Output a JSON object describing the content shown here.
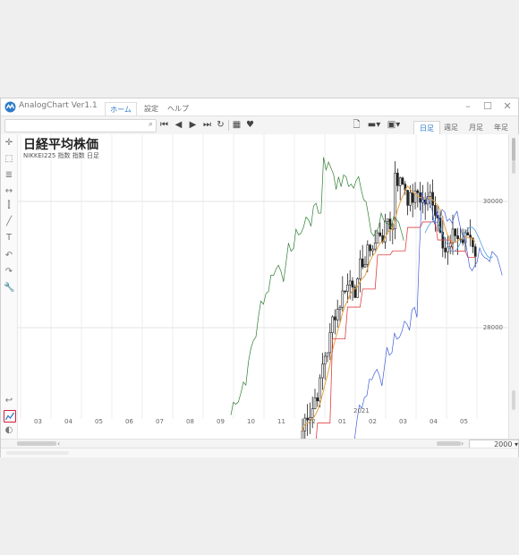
{
  "app": {
    "title": "AnalogChart Ver1.1"
  },
  "menu": {
    "tabs": [
      "ホーム",
      "設定",
      "ヘルプ"
    ],
    "active": 0
  },
  "toolbar": {
    "search_icon": "search-icon",
    "period_tabs": [
      "日足",
      "週足",
      "月足",
      "年足"
    ],
    "active_period": 0
  },
  "chart": {
    "title": "日経平均株価",
    "subtitle": "NIKKEI225  指数  指数  日足",
    "y_labels": [
      "30000",
      "28000"
    ],
    "year_label": "2021",
    "month_labels": [
      "03",
      "04",
      "05",
      "06",
      "07",
      "08",
      "09",
      "10",
      "11",
      "12",
      "01",
      "02",
      "03",
      "04",
      "05"
    ]
  },
  "footer": {
    "year_select": "2000"
  },
  "chart_data": {
    "type": "line",
    "title": "日経平均株価",
    "ylim": [
      26000,
      31000
    ],
    "y_ticks": [
      28000,
      30000
    ],
    "colors": {
      "candle": "#222222",
      "orange": "#e8a040",
      "red": "#e04040",
      "blue": "#4060d8",
      "green": "#2e7d32",
      "lightblue": "#4aa0e0"
    },
    "grid": true
  }
}
